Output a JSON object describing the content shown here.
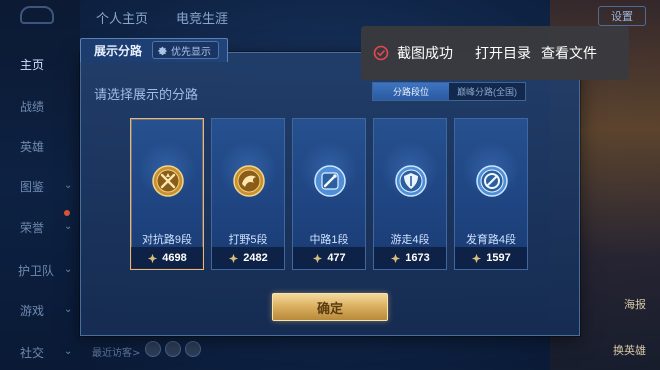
{
  "background": {
    "top_tabs": [
      "个人主页",
      "电竞生涯"
    ],
    "sidebar_items": [
      {
        "label": "主页",
        "active": true,
        "chevron": false
      },
      {
        "label": "战绩",
        "active": false,
        "chevron": false
      },
      {
        "label": "英雄",
        "active": false,
        "chevron": false
      },
      {
        "label": "图鉴",
        "active": false,
        "chevron": true
      },
      {
        "label": "荣誉",
        "active": false,
        "chevron": true
      },
      {
        "label": "护卫队",
        "active": false,
        "chevron": true
      },
      {
        "label": "游戏",
        "active": false,
        "chevron": true
      },
      {
        "label": "社交",
        "active": false,
        "chevron": true
      }
    ],
    "settings_label": "设置",
    "right_labels": [
      "海报",
      "换英雄"
    ],
    "recent_visitors_label": "最近访客>"
  },
  "dialog": {
    "title": "展示分路",
    "priority_label": "优先显示",
    "prompt": "请选择展示的分路",
    "toggle": [
      {
        "label": "分路段位",
        "active": true
      },
      {
        "label": "巅峰分路(全国)",
        "active": false
      }
    ],
    "cards": [
      {
        "label": "对抗路9段",
        "score": "4698",
        "selected": true,
        "badge": "gold-sword-badge-icon"
      },
      {
        "label": "打野5段",
        "score": "2482",
        "selected": false,
        "badge": "gold-dragon-badge-icon"
      },
      {
        "label": "中路1段",
        "score": "477",
        "selected": false,
        "badge": "blue-wand-badge-icon"
      },
      {
        "label": "游走4段",
        "score": "1673",
        "selected": false,
        "badge": "blue-shield-badge-icon"
      },
      {
        "label": "发育路4段",
        "score": "1597",
        "selected": false,
        "badge": "blue-target-badge-icon"
      }
    ],
    "confirm_label": "确定"
  },
  "toast": {
    "status": "截图成功",
    "open_dir": "打开目录",
    "view_file": "查看文件"
  },
  "colors": {
    "accent_gold": "#d9ae5e",
    "selected_border": "#e8b87a",
    "toast_icon_red": "#e5484d"
  }
}
